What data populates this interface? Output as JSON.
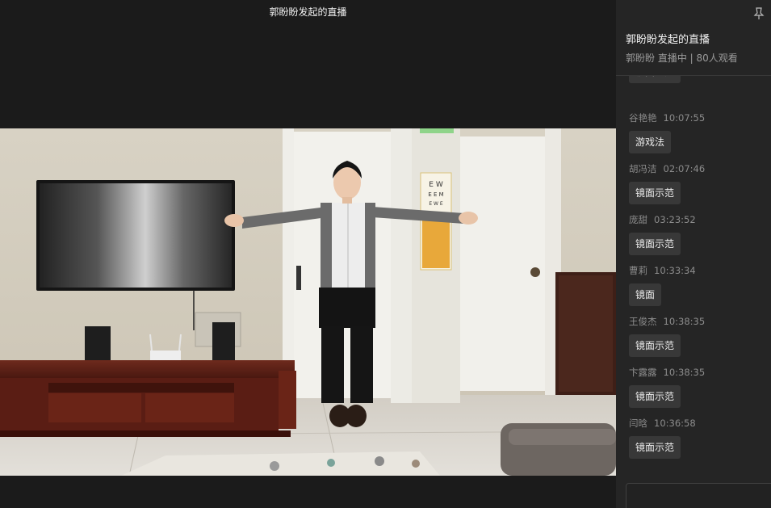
{
  "window": {
    "title": "郭盼盼发起的直播"
  },
  "room": {
    "title": "郭盼盼发起的直播",
    "meta": "郭盼盼 直播中 | 80人观看"
  },
  "eye_chart_letters": "E W\nE E M\nE W E",
  "messages": [
    {
      "user": "",
      "time": "",
      "text": "镜面示范"
    },
    {
      "user": "谷艳艳",
      "time": "10:07:55",
      "text": "游戏法"
    },
    {
      "user": "胡冯洁",
      "time": "02:07:46",
      "text": "镜面示范"
    },
    {
      "user": "庞甜",
      "time": "03:23:52",
      "text": "镜面示范"
    },
    {
      "user": "曹莉",
      "time": "10:33:34",
      "text": "镜面"
    },
    {
      "user": "王俊杰",
      "time": "10:38:35",
      "text": "镜面示范"
    },
    {
      "user": "卞露露",
      "time": "10:38:35",
      "text": "镜面示范"
    },
    {
      "user": "闫晗",
      "time": "10:36:58",
      "text": "镜面示范"
    }
  ]
}
